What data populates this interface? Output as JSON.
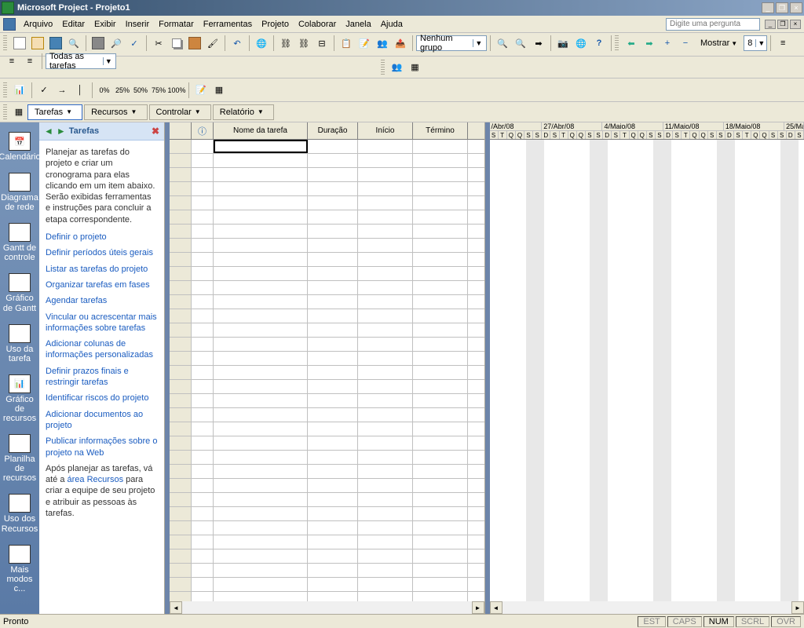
{
  "title": "Microsoft Project - Projeto1",
  "menu": {
    "items": [
      "Arquivo",
      "Editar",
      "Exibir",
      "Inserir",
      "Formatar",
      "Ferramentas",
      "Projeto",
      "Colaborar",
      "Janela",
      "Ajuda"
    ],
    "help_placeholder": "Digite uma pergunta"
  },
  "toolbar": {
    "group_combo": "Nenhum grupo",
    "show_label": "Mostrar",
    "font_size": "8",
    "filter_combo": "Todas as tarefas"
  },
  "pct_buttons": [
    "0%",
    "25%",
    "50%",
    "75%",
    "100%"
  ],
  "viewtabs": {
    "tarefas": "Tarefas",
    "recursos": "Recursos",
    "controlar": "Controlar",
    "relatorio": "Relatório"
  },
  "viewbar": {
    "items": [
      {
        "label": "Calendário"
      },
      {
        "label": "Diagrama de rede"
      },
      {
        "label": "Gantt de controle"
      },
      {
        "label": "Gráfico de Gantt"
      },
      {
        "label": "Uso da tarefa"
      },
      {
        "label": "Gráfico de recursos"
      },
      {
        "label": "Planilha de recursos"
      },
      {
        "label": "Uso dos Recursos"
      },
      {
        "label": "Mais modos c..."
      }
    ]
  },
  "guide": {
    "title": "Tarefas",
    "intro": "Planejar as tarefas do projeto e criar um cronograma para elas clicando em um item abaixo. Serão exibidas ferramentas e instruções para concluir a etapa correspondente.",
    "links": [
      "Definir o projeto",
      "Definir períodos úteis gerais",
      "Listar as tarefas do projeto",
      "Organizar tarefas em fases",
      "Agendar tarefas",
      "Vincular ou acrescentar mais informações sobre tarefas",
      "Adicionar colunas de informações personalizadas",
      "Definir prazos finais e restringir tarefas",
      "Identificar riscos do projeto",
      "Adicionar documentos ao projeto",
      "Publicar informações sobre o projeto na Web"
    ],
    "outro_pre": "Após planejar as tarefas, vá até a ",
    "outro_link": "área Recursos",
    "outro_post": " para criar a equipe de seu projeto e atribuir as pessoas às tarefas."
  },
  "grid": {
    "columns": {
      "info": "ⓘ",
      "name": "Nome da tarefa",
      "duration": "Duração",
      "start": "Início",
      "end": "Término"
    }
  },
  "gantt": {
    "weeks": [
      "/Abr/08",
      "27/Abr/08",
      "4/Maio/08",
      "11/Maio/08",
      "18/Maio/08",
      "25/Ma"
    ],
    "days": [
      "S",
      "T",
      "Q",
      "Q",
      "S",
      "S",
      "D",
      "S",
      "T",
      "Q",
      "Q",
      "S",
      "S",
      "D",
      "S",
      "T",
      "Q",
      "Q",
      "S",
      "S",
      "D",
      "S",
      "T",
      "Q",
      "Q",
      "S",
      "S",
      "D",
      "S",
      "T",
      "Q",
      "Q",
      "S",
      "S",
      "D",
      "S"
    ]
  },
  "status": {
    "ready": "Pronto",
    "indicators": [
      {
        "label": "EST",
        "on": false
      },
      {
        "label": "CAPS",
        "on": false
      },
      {
        "label": "NUM",
        "on": true
      },
      {
        "label": "SCRL",
        "on": false
      },
      {
        "label": "OVR",
        "on": false
      }
    ]
  }
}
